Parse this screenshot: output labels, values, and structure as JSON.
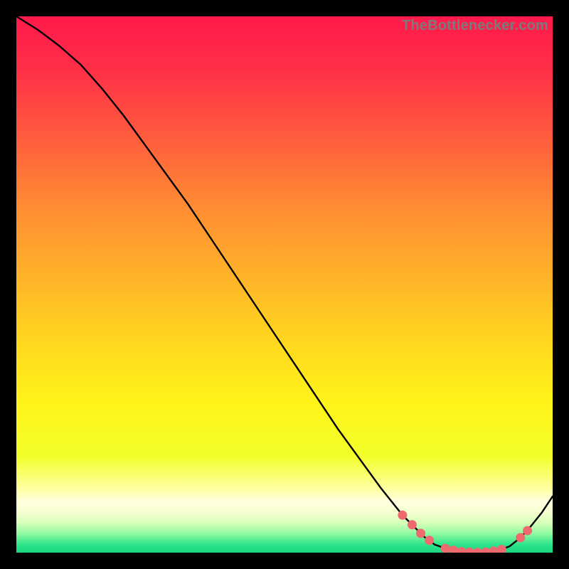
{
  "attribution": "TheBottlenecker.com",
  "chart_data": {
    "type": "line",
    "title": "",
    "xlabel": "",
    "ylabel": "",
    "xlim": [
      0,
      100
    ],
    "ylim": [
      0,
      100
    ],
    "grid": false,
    "series": [
      {
        "name": "curve",
        "color": "#000000",
        "x": [
          0,
          4,
          8,
          12,
          16,
          20,
          24,
          28,
          32,
          36,
          40,
          44,
          48,
          52,
          56,
          60,
          64,
          68,
          72,
          76,
          78,
          80,
          82,
          84,
          86,
          88,
          90,
          92,
          94,
          96,
          98,
          100
        ],
        "y": [
          100,
          97.5,
          94.5,
          91,
          86.5,
          81.5,
          76,
          70.5,
          65,
          59,
          53,
          47,
          41,
          35,
          29,
          23,
          17.5,
          12,
          7,
          3,
          1.5,
          0.8,
          0.3,
          0.1,
          0.05,
          0.1,
          0.4,
          1.2,
          2.8,
          5,
          7.5,
          10.5
        ]
      }
    ],
    "markers": [
      {
        "x": 72.0,
        "y": 7.0
      },
      {
        "x": 73.8,
        "y": 5.2
      },
      {
        "x": 75.4,
        "y": 3.6
      },
      {
        "x": 77.0,
        "y": 2.3
      },
      {
        "x": 80.0,
        "y": 0.8
      },
      {
        "x": 81.5,
        "y": 0.45
      },
      {
        "x": 83.0,
        "y": 0.2
      },
      {
        "x": 84.5,
        "y": 0.1
      },
      {
        "x": 86.0,
        "y": 0.05
      },
      {
        "x": 87.5,
        "y": 0.1
      },
      {
        "x": 89.0,
        "y": 0.3
      },
      {
        "x": 90.5,
        "y": 0.6
      },
      {
        "x": 94.0,
        "y": 2.8
      },
      {
        "x": 95.3,
        "y": 4.1
      }
    ],
    "gradient_stops": [
      {
        "offset": 0.0,
        "color": "#ff1a4b"
      },
      {
        "offset": 0.1,
        "color": "#ff2f47"
      },
      {
        "offset": 0.22,
        "color": "#ff5a3e"
      },
      {
        "offset": 0.35,
        "color": "#ff8a33"
      },
      {
        "offset": 0.48,
        "color": "#ffb129"
      },
      {
        "offset": 0.6,
        "color": "#ffd61f"
      },
      {
        "offset": 0.72,
        "color": "#fff31a"
      },
      {
        "offset": 0.82,
        "color": "#f2ff2a"
      },
      {
        "offset": 0.88,
        "color": "#ffffa0"
      },
      {
        "offset": 0.905,
        "color": "#ffffe0"
      },
      {
        "offset": 0.925,
        "color": "#f5ffd0"
      },
      {
        "offset": 0.945,
        "color": "#d6ffb8"
      },
      {
        "offset": 0.965,
        "color": "#8cf9a0"
      },
      {
        "offset": 0.985,
        "color": "#2ee58b"
      },
      {
        "offset": 1.0,
        "color": "#18d67e"
      }
    ]
  }
}
